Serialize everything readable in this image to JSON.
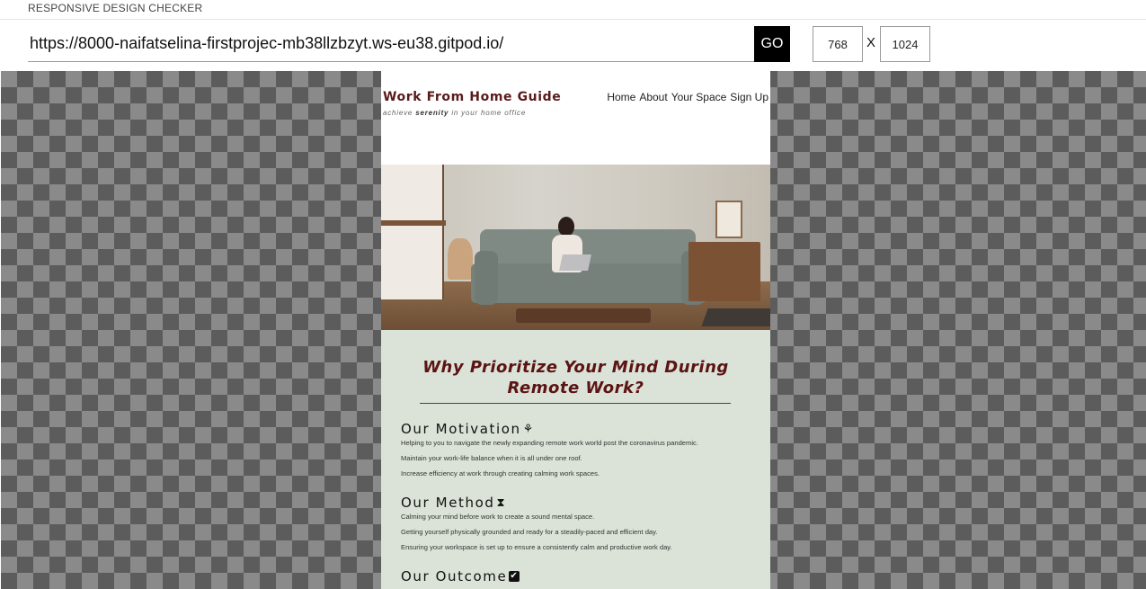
{
  "app": {
    "title": "RESPONSIVE DESIGN CHECKER",
    "url": "https://8000-naifatselina-firstprojec-mb38llzbzyt.ws-eu38.gitpod.io/",
    "go_label": "GO",
    "width_value": "768",
    "height_value": "1024",
    "separator": "X"
  },
  "site": {
    "brand": "Work From Home Guide",
    "tagline_pre": "achieve ",
    "tagline_bold": "serenity",
    "tagline_post": " in your home office",
    "nav": [
      "Home",
      "About",
      "Your Space",
      "Sign Up"
    ],
    "heading": "Why Prioritize Your Mind During Remote Work?",
    "sections": [
      {
        "title": "Our Motivation",
        "icon": "seedling-icon",
        "lines": [
          "Helping to you to navigate the newly expanding remote work world post the coronavirus pandemic.",
          "Maintain your work-life balance when it is all under one roof.",
          "Increase efficiency at work through creating calming work spaces."
        ]
      },
      {
        "title": "Our Method",
        "icon": "hourglass-icon",
        "lines": [
          "Calming your mind before work to create a sound mental space.",
          "Getting yourself physically grounded and ready for a steadily-paced and efficient day.",
          "Ensuring your workspace is set up to ensure a consistently calm and productive work day."
        ]
      },
      {
        "title": "Our Outcome",
        "icon": "check-square-icon",
        "lines": []
      }
    ]
  }
}
